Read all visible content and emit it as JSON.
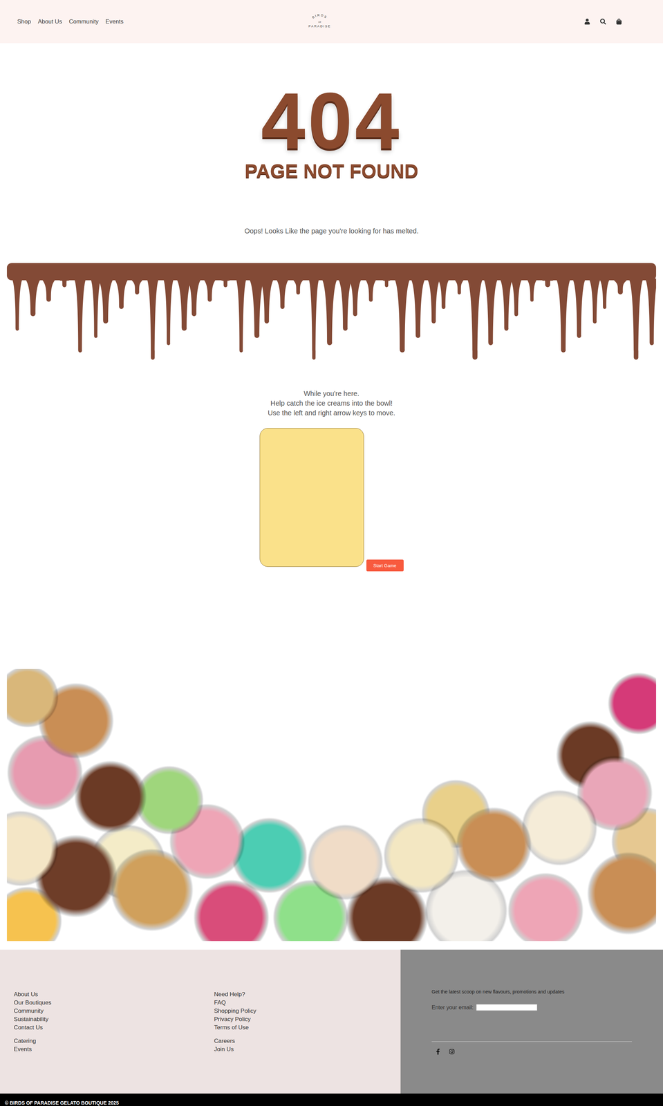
{
  "header": {
    "nav": [
      "Shop",
      "About Us",
      "Community",
      "Events"
    ],
    "logo": {
      "top": "BIRDS",
      "middle": "OF",
      "bottom": "PARADISE"
    }
  },
  "hero": {
    "code": "404",
    "title": "PAGE NOT FOUND",
    "message": "Oops! Looks Like the page you're looking for has melted."
  },
  "game": {
    "instructions": [
      "While you're here.",
      "Help catch the ice creams into the bowl!",
      "Use the left and right arrow keys to move."
    ],
    "button": "Start Game"
  },
  "footer": {
    "columns": [
      {
        "groups": [
          [
            "About Us",
            "Our Boutiques",
            "Community",
            "Sustainability",
            "Contact Us"
          ],
          [
            "Catering",
            "Events"
          ]
        ]
      },
      {
        "groups": [
          [
            "Need Help?",
            "FAQ",
            "Shopping Policy",
            "Privacy Policy",
            "Terms of Use"
          ],
          [
            "Careers",
            "Join Us"
          ]
        ]
      }
    ],
    "newsletter": {
      "text": "Get the latest scoop on new flavours, promotions and updates",
      "label": "Enter your email:",
      "value": ""
    },
    "copyright": "© BIRDS OF PARADISE GELATO BOUTIQUE 2025"
  }
}
